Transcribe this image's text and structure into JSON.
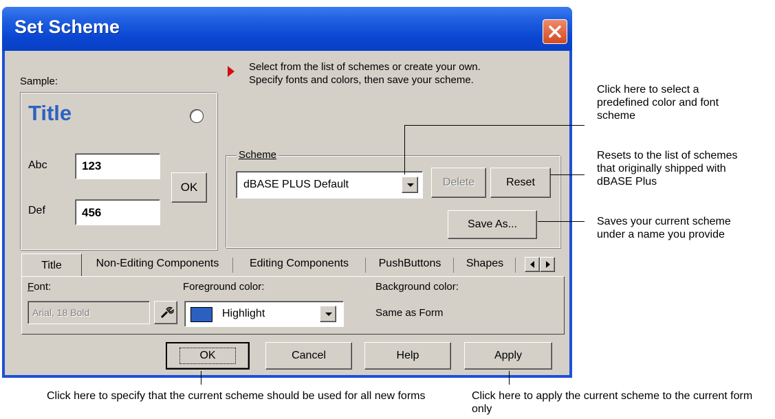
{
  "window": {
    "title": "Set Scheme"
  },
  "hint": {
    "line1": "Select from the list of schemes or create your own.",
    "line2": "Specify fonts and colors, then save your scheme."
  },
  "sample": {
    "label": "Sample:",
    "title_text": "Title",
    "abc_label": "Abc",
    "abc_value": "123",
    "def_label": "Def",
    "def_value": "456",
    "ok_label": "OK"
  },
  "scheme": {
    "group_label": "Scheme",
    "selected": "dBASE PLUS Default",
    "delete_label": "Delete",
    "reset_label": "Reset",
    "save_as_label": "Save As..."
  },
  "tabs": [
    "Title",
    "Non-Editing Components",
    "Editing Components",
    "PushButtons",
    "Shapes"
  ],
  "title_tab": {
    "font_label": "Font:",
    "font_value": "Arial, 18 Bold",
    "fg_label": "Foreground color:",
    "fg_value": "Highlight",
    "fg_swatch": "#2b5fc0",
    "bg_label": "Background color:",
    "bg_value": "Same as Form"
  },
  "buttons": {
    "ok": "OK",
    "cancel": "Cancel",
    "help": "Help",
    "apply": "Apply"
  },
  "annotations": {
    "select_scheme": "Click here to select a predefined color and font scheme",
    "reset": "Resets to the list of schemes that originally shipped with dBASE Plus",
    "save_as": "Saves your current scheme under a name you provide",
    "ok": "Click here to specify that the current scheme should be used for all new forms",
    "apply": "Click here to apply the current scheme to the current form only"
  }
}
